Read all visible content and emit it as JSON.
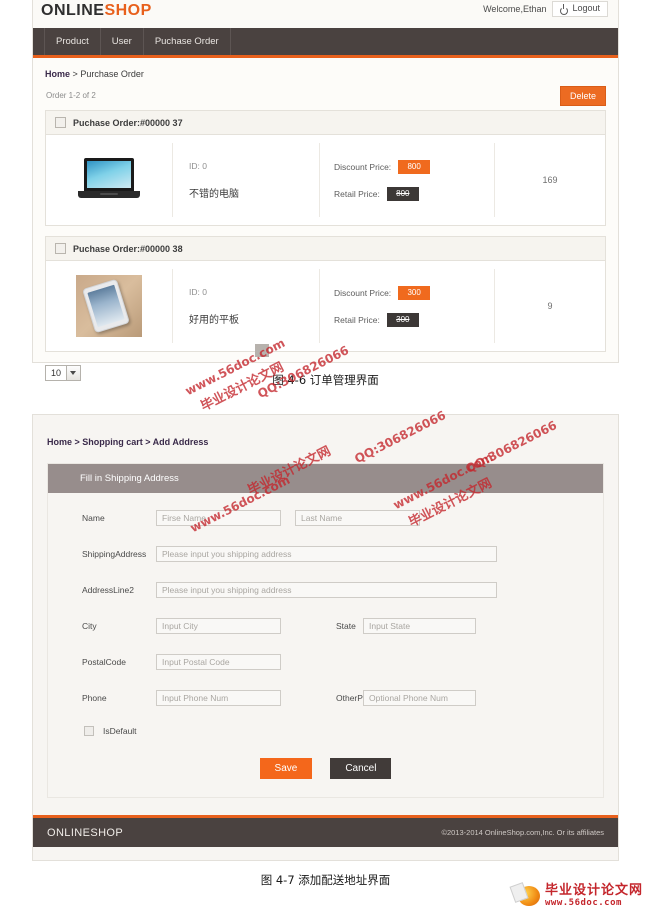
{
  "figure_order_management": {
    "header": {
      "brand_online": "ONLINE",
      "brand_shop": "SHOP",
      "welcome": "Welcome,Ethan",
      "logout_label": "Logout",
      "logout_icon": "power-icon"
    },
    "nav": [
      {
        "label": "Product"
      },
      {
        "label": "User"
      },
      {
        "label": "Puchase Order"
      }
    ],
    "breadcrumb": {
      "home": "Home",
      "separator": ">",
      "current": "Purchase Order"
    },
    "count_text": "Order 1-2 of 2",
    "delete_button": "Delete",
    "orders": [
      {
        "title": "Puchase Order:#00000 37",
        "thumbnail": "laptop-image",
        "product_id": "ID: 0",
        "product_name": "不错的电脑",
        "discount_label": "Discount Price:",
        "discount_value": "800",
        "retail_label": "Retail Price:",
        "retail_value": "800",
        "quantity": "169"
      },
      {
        "title": "Puchase Order:#00000 38",
        "thumbnail": "tablet-image",
        "product_id": "ID: 0",
        "product_name": "好用的平板",
        "discount_label": "Discount Price:",
        "discount_value": "300",
        "retail_label": "Retail Price:",
        "retail_value": "300",
        "quantity": "9"
      }
    ],
    "page_size": "10",
    "caption": "图 4-6 订单管理界面"
  },
  "figure_add_address": {
    "breadcrumb": "Home > Shopping cart > Add Address",
    "panel_title": "Fill in Shipping Address",
    "fields": [
      {
        "label": "Name",
        "placeholder": "Firse Name",
        "value": "",
        "second_placeholder": "Last Name",
        "second_value": ""
      },
      {
        "label": "ShippingAddress",
        "placeholder": "Please input you shipping address",
        "value": ""
      },
      {
        "label": "AddressLine2",
        "placeholder": "Please input you shipping address",
        "value": ""
      },
      {
        "label": "City",
        "placeholder": "Input City",
        "value": "",
        "second_label": "State",
        "second_placeholder": "Input State",
        "second_value": ""
      },
      {
        "label": "PostalCode",
        "placeholder": "Input Postal Code",
        "value": ""
      },
      {
        "label": "Phone",
        "placeholder": "Input Phone Num",
        "value": "",
        "second_label": "OtherPhone",
        "second_placeholder": "Optional Phone Num",
        "second_value": ""
      }
    ],
    "is_default_label": "IsDefault",
    "save_button": "Save",
    "cancel_button": "Cancel",
    "footer": {
      "brand": "ONLINESHOP",
      "copyright": "©2013-2014 OnlineShop.com,Inc. Or its affiliates"
    },
    "caption": "图 4-7 添加配送地址界面"
  },
  "watermarks": [
    {
      "text": "毕业设计论文网"
    },
    {
      "text": "www.56doc.com"
    },
    {
      "text": "QQ:306826066"
    },
    {
      "text": "毕业设计论文网"
    },
    {
      "text": "www.56doc.com"
    },
    {
      "text": "QQ:306826066"
    }
  ],
  "site_logo": {
    "title": "毕业设计论文网",
    "url": "www.56doc.com"
  },
  "colors": {
    "accent_orange": "#e8601c",
    "nav_dark": "#4a4240",
    "panel_gray": "#978d8c",
    "badge_orange": "#f06a1e",
    "badge_dark": "#3c3836"
  }
}
